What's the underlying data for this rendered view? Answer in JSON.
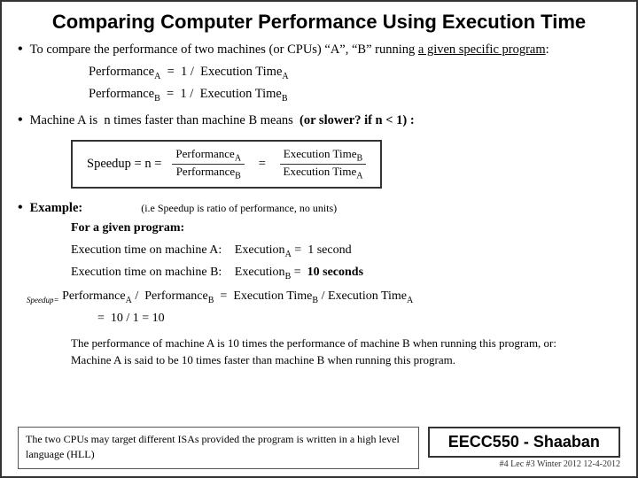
{
  "slide": {
    "title": "Comparing Computer Performance Using Execution Time",
    "bullet1": {
      "intro": "To compare the performance of two machines (or CPUs) “A”, “B” running a given specific program:",
      "formula1": "Performanceₐ =  1 /  Execution Timeₐ",
      "formula2": "Performanceᴮ =  1 /  Execution Timeᴮ"
    },
    "bullet2": {
      "text": "Machine A is  n times faster than machine B means  (or slower? if n < 1) :"
    },
    "speedup_box": {
      "left": "Speedup = n =",
      "numerator": "Performanceₐ",
      "denominator": "Performanceᴮ",
      "equals": "=",
      "num2": "Execution Timeᴮ",
      "den2": "Execution Timeₐ"
    },
    "bullet3": {
      "label": "Example:",
      "note": "(i.e Speedup is ratio of performance, no units)",
      "program_label": "For a given program:",
      "lineA_label": "Execution time on machine A:",
      "lineA_value": "Executionₐ =  1 second",
      "lineB_label": "Execution time on machine B:",
      "lineB_value": "Executionᴮ =  10 seconds",
      "speedup_line1": "Performanceₐ /  Performanceᴮ  =  Execution Timeᴮ  /  Execution Timeₐ",
      "speedup_line2": "=  10 / 1 = 10",
      "speedup_prefix": "Speedup="
    },
    "perf_text": "The performance of machine A  is 10 times the performance of machine B when running this program, or:  Machine A is said to be 10 times faster than machine B when running this program.",
    "bottom_note": "The two CPUs may target different ISAs  provided the program is written in a high level language (HLL)",
    "bottom_badge": "EECC550 - Shaaban",
    "meta": "#4   Lec #3   Winter 2012   12-4-2012"
  }
}
